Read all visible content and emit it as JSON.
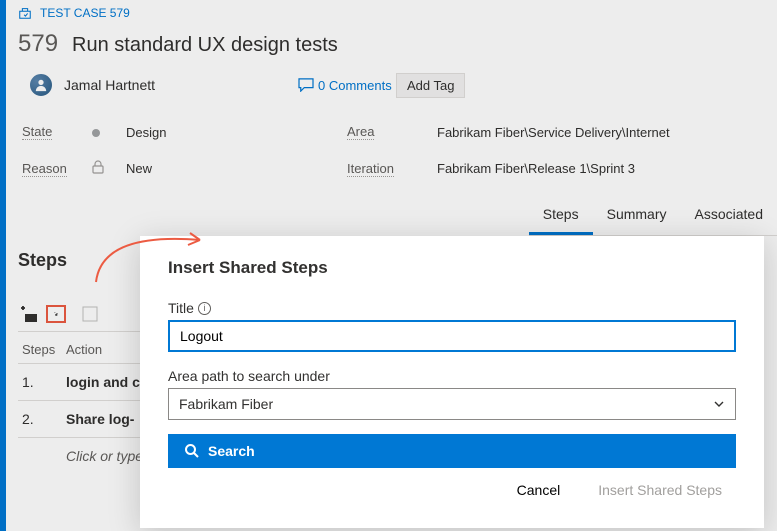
{
  "itemType": "TEST CASE 579",
  "itemId": "579",
  "itemTitle": "Run standard UX design tests",
  "assignee": "Jamal Hartnett",
  "commentsCount": "0 Comments",
  "addTagLabel": "Add Tag",
  "fields": {
    "stateLabel": "State",
    "stateValue": "Design",
    "reasonLabel": "Reason",
    "reasonValue": "New",
    "areaLabel": "Area",
    "areaValue": "Fabrikam Fiber\\Service Delivery\\Internet",
    "iterationLabel": "Iteration",
    "iterationValue": "Fabrikam Fiber\\Release 1\\Sprint 3"
  },
  "tabs": {
    "steps": "Steps",
    "summary": "Summary",
    "associated": "Associated"
  },
  "steps": {
    "heading": "Steps",
    "colStepNo": "Steps",
    "colAction": "Action",
    "rows": [
      {
        "idx": "1.",
        "action": "login and c"
      },
      {
        "idx": "2.",
        "action": "Share log-"
      }
    ],
    "hint": "Click or type"
  },
  "dialog": {
    "title": "Insert Shared Steps",
    "titleFieldLabel": "Title",
    "titleFieldValue": "Logout",
    "areaPathLabel": "Area path to search under",
    "areaPathValue": "Fabrikam Fiber",
    "searchLabel": "Search",
    "cancelLabel": "Cancel",
    "insertLabel": "Insert Shared Steps"
  }
}
